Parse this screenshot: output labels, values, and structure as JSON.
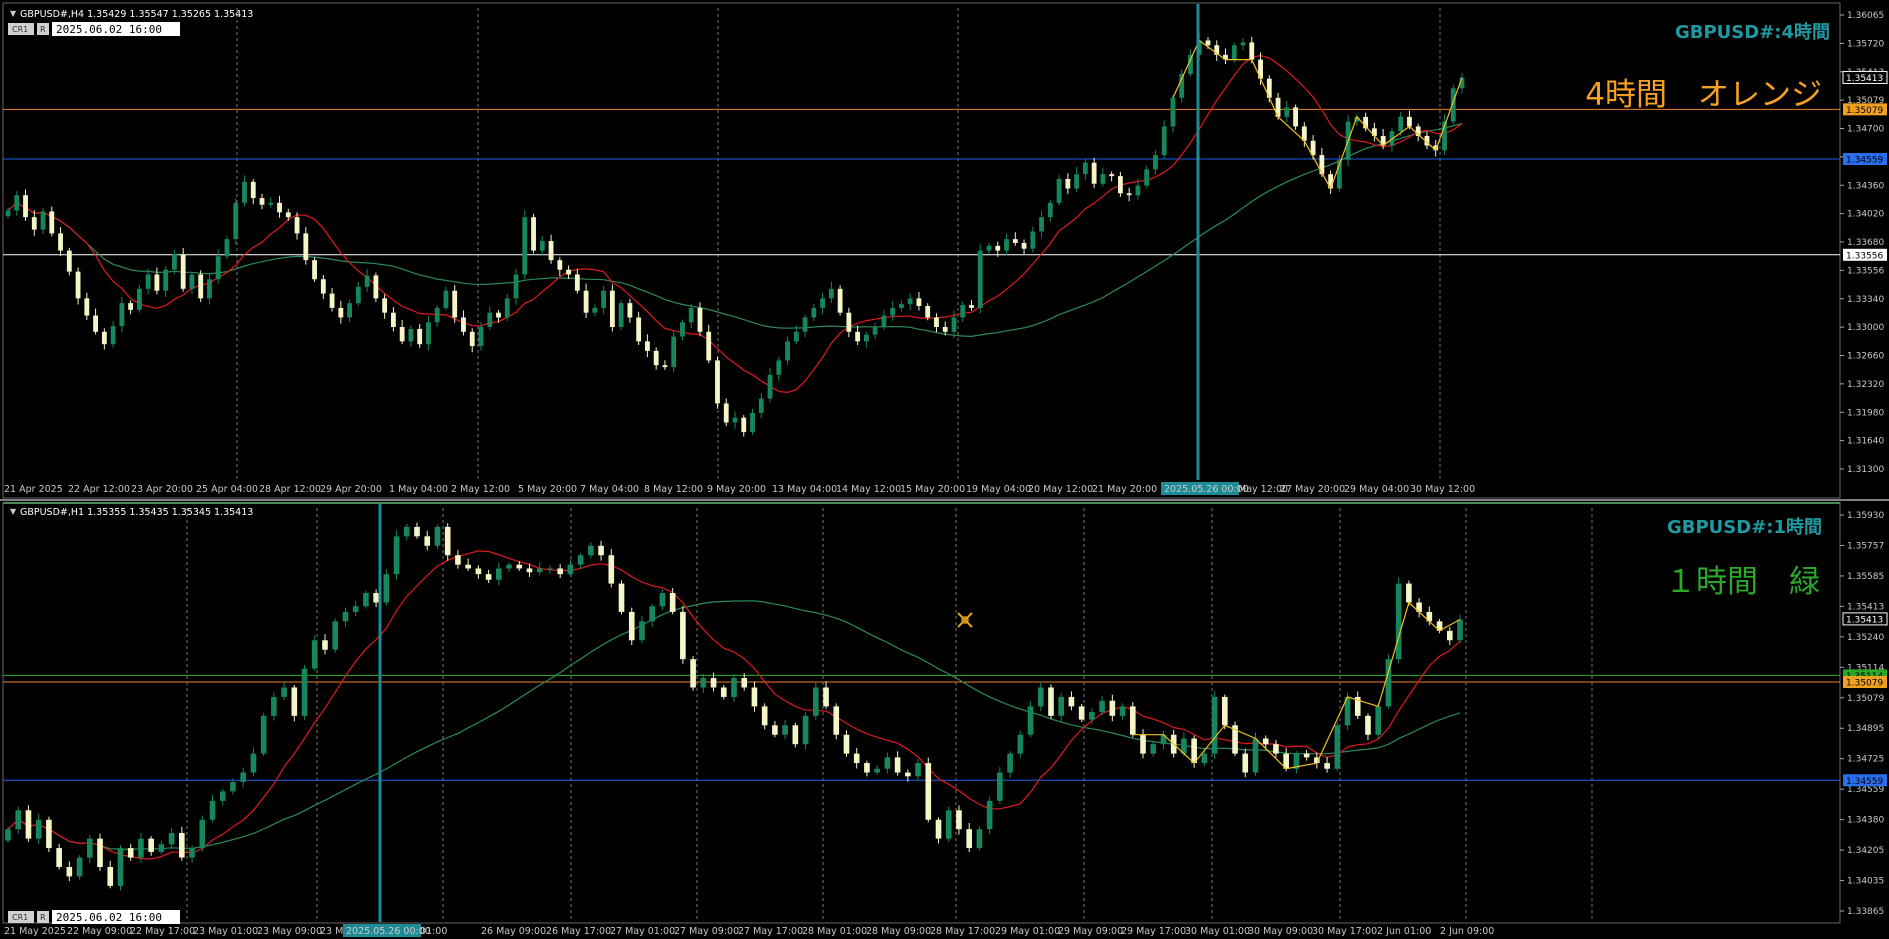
{
  "colors": {
    "background": "#000000",
    "bull": "#16865c",
    "bear": "#f5f5c8",
    "ma_fast": "#e0191e",
    "ma_slow": "#2c8a5a",
    "zigzag": "#f0c020",
    "orange_line": "#f08020",
    "blue_line": "#2060f0",
    "white_line": "#ffffff",
    "green_line": "#30b030",
    "cursor_line": "#1e8c96",
    "title": "#1e9aa0"
  },
  "icons": {
    "cursor": "crosshair-cursor-icon"
  },
  "top": {
    "ohlc_text": "GBPUSD#,H4  1.35429 1.35547 1.35265 1.35413",
    "title": "GBPUSD#:4時間",
    "label": "4時間　オレンジ",
    "label_color": "#f5a020",
    "time_box": "2025.06.02 16:00",
    "buttons": [
      "CR1",
      "R"
    ],
    "cursor_date": "2025.05.26 00:00",
    "x_labels": [
      "21 Apr 2025",
      "22 Apr 12:00",
      "23 Apr 20:00",
      "25 Apr 04:00",
      "28 Apr 12:00",
      "29 Apr 20:00",
      "1 May 04:00",
      "2 May 12:00",
      "5 May 20:00",
      "7 May 04:00",
      "8 May 12:00",
      "9 May 20:00",
      "13 May 04:00",
      "14 May 12:00",
      "15 May 20:00",
      "19 May 04:00",
      "20 May 12:00",
      "21 May 20:00",
      "27 May 20:00",
      "29 May 04:00",
      "30 May 12:00"
    ],
    "extra_x_label": "May 12:00",
    "price_labels": [
      "1.36065",
      "1.35720",
      "1.35413",
      "1.35079",
      "1.34700",
      "1.34559",
      "1.34360",
      "1.34020",
      "1.33680",
      "1.33556",
      "1.33340",
      "1.33000",
      "1.32660",
      "1.32320",
      "1.31980",
      "1.31640",
      "1.31300"
    ],
    "marks": [
      {
        "price": "1.35413",
        "kind": "current"
      },
      {
        "price": "1.35079",
        "kind": "orange"
      },
      {
        "price": "1.34559",
        "kind": "blue"
      },
      {
        "price": "1.33556",
        "kind": "white"
      }
    ]
  },
  "bottom": {
    "ohlc_text": "GBPUSD#,H1  1.35355 1.35435 1.35345 1.35413",
    "title": "GBPUSD#:1時間",
    "label": "１時間　緑",
    "label_color": "#2aa82a",
    "time_box": "2025.06.02 16:00",
    "buttons": [
      "CR1",
      "R"
    ],
    "cursor_date": "2025.05.26 00:00",
    "x_labels": [
      "21 May 2025",
      "22 May 09:00",
      "22 May 17:00",
      "23 May 01:00",
      "23 May 09:00",
      "23 M",
      "01:00",
      "26 May 09:00",
      "26 May 17:00",
      "27 May 01:00",
      "27 May 09:00",
      "27 May 17:00",
      "28 May 01:00",
      "28 May 09:00",
      "28 May 17:00",
      "29 May 01:00",
      "29 May 09:00",
      "29 May 17:00",
      "30 May 01:00",
      "30 May 09:00",
      "30 May 17:00",
      "2 Jun 01:00",
      "2 Jun 09:00"
    ],
    "price_labels": [
      "1.35930",
      "1.35757",
      "1.35585",
      "1.35413",
      "1.35240",
      "1.35114",
      "1.35079",
      "1.34895",
      "1.34725",
      "1.34559",
      "1.34380",
      "1.34205",
      "1.34035",
      "1.33865"
    ],
    "marks": [
      {
        "price": "1.35413",
        "kind": "current"
      },
      {
        "price": "1.35114",
        "kind": "green"
      },
      {
        "price": "1.35079",
        "kind": "orange"
      },
      {
        "price": "1.34559",
        "kind": "blue"
      }
    ]
  },
  "chart_data": [
    {
      "type": "candlestick",
      "symbol": "GBPUSD#",
      "timeframe": "H4",
      "title": "GBPUSD#:4時間",
      "ylim": [
        1.3124,
        1.3614
      ],
      "levels": [
        {
          "name": "orange",
          "value": 1.35079
        },
        {
          "name": "blue",
          "value": 1.34559
        },
        {
          "name": "white",
          "value": 1.33556
        }
      ],
      "close": [
        1.3402,
        1.3418,
        1.3395,
        1.3382,
        1.3401,
        1.3378,
        1.336,
        1.3338,
        1.331,
        1.3292,
        1.3275,
        1.3262,
        1.3281,
        1.3305,
        1.3298,
        1.332,
        1.3335,
        1.3318,
        1.334,
        1.3356,
        1.332,
        1.3335,
        1.331,
        1.333,
        1.3354,
        1.3372,
        1.341,
        1.3432,
        1.3415,
        1.3408,
        1.341,
        1.34,
        1.3395,
        1.3378,
        1.335,
        1.333,
        1.3315,
        1.33,
        1.329,
        1.3305,
        1.3322,
        1.3334,
        1.331,
        1.3295,
        1.328,
        1.3265,
        1.3278,
        1.3262,
        1.3285,
        1.33,
        1.3318,
        1.329,
        1.3275,
        1.326,
        1.328,
        1.3295,
        1.329,
        1.331,
        1.3335,
        1.3395,
        1.336,
        1.337,
        1.335,
        1.334,
        1.3335,
        1.3318,
        1.3295,
        1.33,
        1.3318,
        1.328,
        1.3305,
        1.329,
        1.3265,
        1.3255,
        1.324,
        1.3238,
        1.327,
        1.3285,
        1.33,
        1.3275,
        1.3245,
        1.32,
        1.318,
        1.3185,
        1.317,
        1.319,
        1.3205,
        1.323,
        1.3245,
        1.3265,
        1.3275,
        1.329,
        1.33,
        1.331,
        1.332,
        1.3295,
        1.3275,
        1.3265,
        1.3272,
        1.328,
        1.3292,
        1.33,
        1.3304,
        1.331,
        1.3302,
        1.329,
        1.328,
        1.3275,
        1.329,
        1.3303,
        1.33,
        1.336,
        1.3365,
        1.336,
        1.3372,
        1.3368,
        1.3362,
        1.338,
        1.3395,
        1.341,
        1.3435,
        1.3425,
        1.344,
        1.3452,
        1.343,
        1.344,
        1.3438,
        1.342,
        1.3418,
        1.3428,
        1.3445,
        1.346,
        1.349,
        1.352,
        1.3545,
        1.3565,
        1.358,
        1.3575,
        1.3565,
        1.356,
        1.3575,
        1.3578,
        1.356,
        1.354,
        1.352,
        1.35,
        1.351,
        1.349,
        1.3475,
        1.346,
        1.344,
        1.3425,
        1.3455,
        1.3495,
        1.35,
        1.3488,
        1.348,
        1.347,
        1.3485,
        1.35,
        1.349,
        1.348,
        1.347,
        1.3465,
        1.3495,
        1.353,
        1.3541
      ]
    },
    {
      "type": "candlestick",
      "symbol": "GBPUSD#",
      "timeframe": "H1",
      "title": "GBPUSD#:1時間",
      "ylim": [
        1.3383,
        1.36
      ],
      "levels": [
        {
          "name": "green",
          "value": 1.35114
        },
        {
          "name": "orange",
          "value": 1.35079
        },
        {
          "name": "blue",
          "value": 1.34559
        }
      ],
      "close": [
        1.343,
        1.344,
        1.3425,
        1.3435,
        1.342,
        1.341,
        1.3405,
        1.3415,
        1.3425,
        1.341,
        1.34,
        1.342,
        1.3415,
        1.3425,
        1.3418,
        1.3422,
        1.3428,
        1.3415,
        1.342,
        1.3435,
        1.3445,
        1.345,
        1.3455,
        1.346,
        1.347,
        1.349,
        1.35,
        1.3505,
        1.349,
        1.3515,
        1.353,
        1.3525,
        1.354,
        1.3545,
        1.3548,
        1.3555,
        1.355,
        1.3565,
        1.3585,
        1.359,
        1.3585,
        1.358,
        1.359,
        1.3575,
        1.357,
        1.3568,
        1.3565,
        1.3562,
        1.3568,
        1.357,
        1.3568,
        1.3566,
        1.3568,
        1.3568,
        1.3565,
        1.357,
        1.3575,
        1.358,
        1.3575,
        1.356,
        1.3545,
        1.353,
        1.354,
        1.3548,
        1.3555,
        1.3545,
        1.352,
        1.3505,
        1.351,
        1.3505,
        1.35,
        1.351,
        1.3505,
        1.3495,
        1.3485,
        1.348,
        1.3485,
        1.3475,
        1.349,
        1.3505,
        1.3495,
        1.348,
        1.347,
        1.3465,
        1.346,
        1.3462,
        1.3468,
        1.346,
        1.3458,
        1.3465,
        1.3435,
        1.3425,
        1.344,
        1.343,
        1.342,
        1.343,
        1.3445,
        1.346,
        1.347,
        1.348,
        1.3495,
        1.3505,
        1.349,
        1.35,
        1.3495,
        1.3488,
        1.3492,
        1.3498,
        1.349,
        1.3495,
        1.348,
        1.347,
        1.3475,
        1.348,
        1.347,
        1.3478,
        1.3465,
        1.347,
        1.35,
        1.3485,
        1.347,
        1.346,
        1.3478,
        1.3475,
        1.347,
        1.3462,
        1.347,
        1.3468,
        1.3465,
        1.3462,
        1.3485,
        1.35,
        1.349,
        1.348,
        1.3495,
        1.352,
        1.356,
        1.355,
        1.3545,
        1.354,
        1.3535,
        1.353,
        1.3541
      ]
    }
  ]
}
